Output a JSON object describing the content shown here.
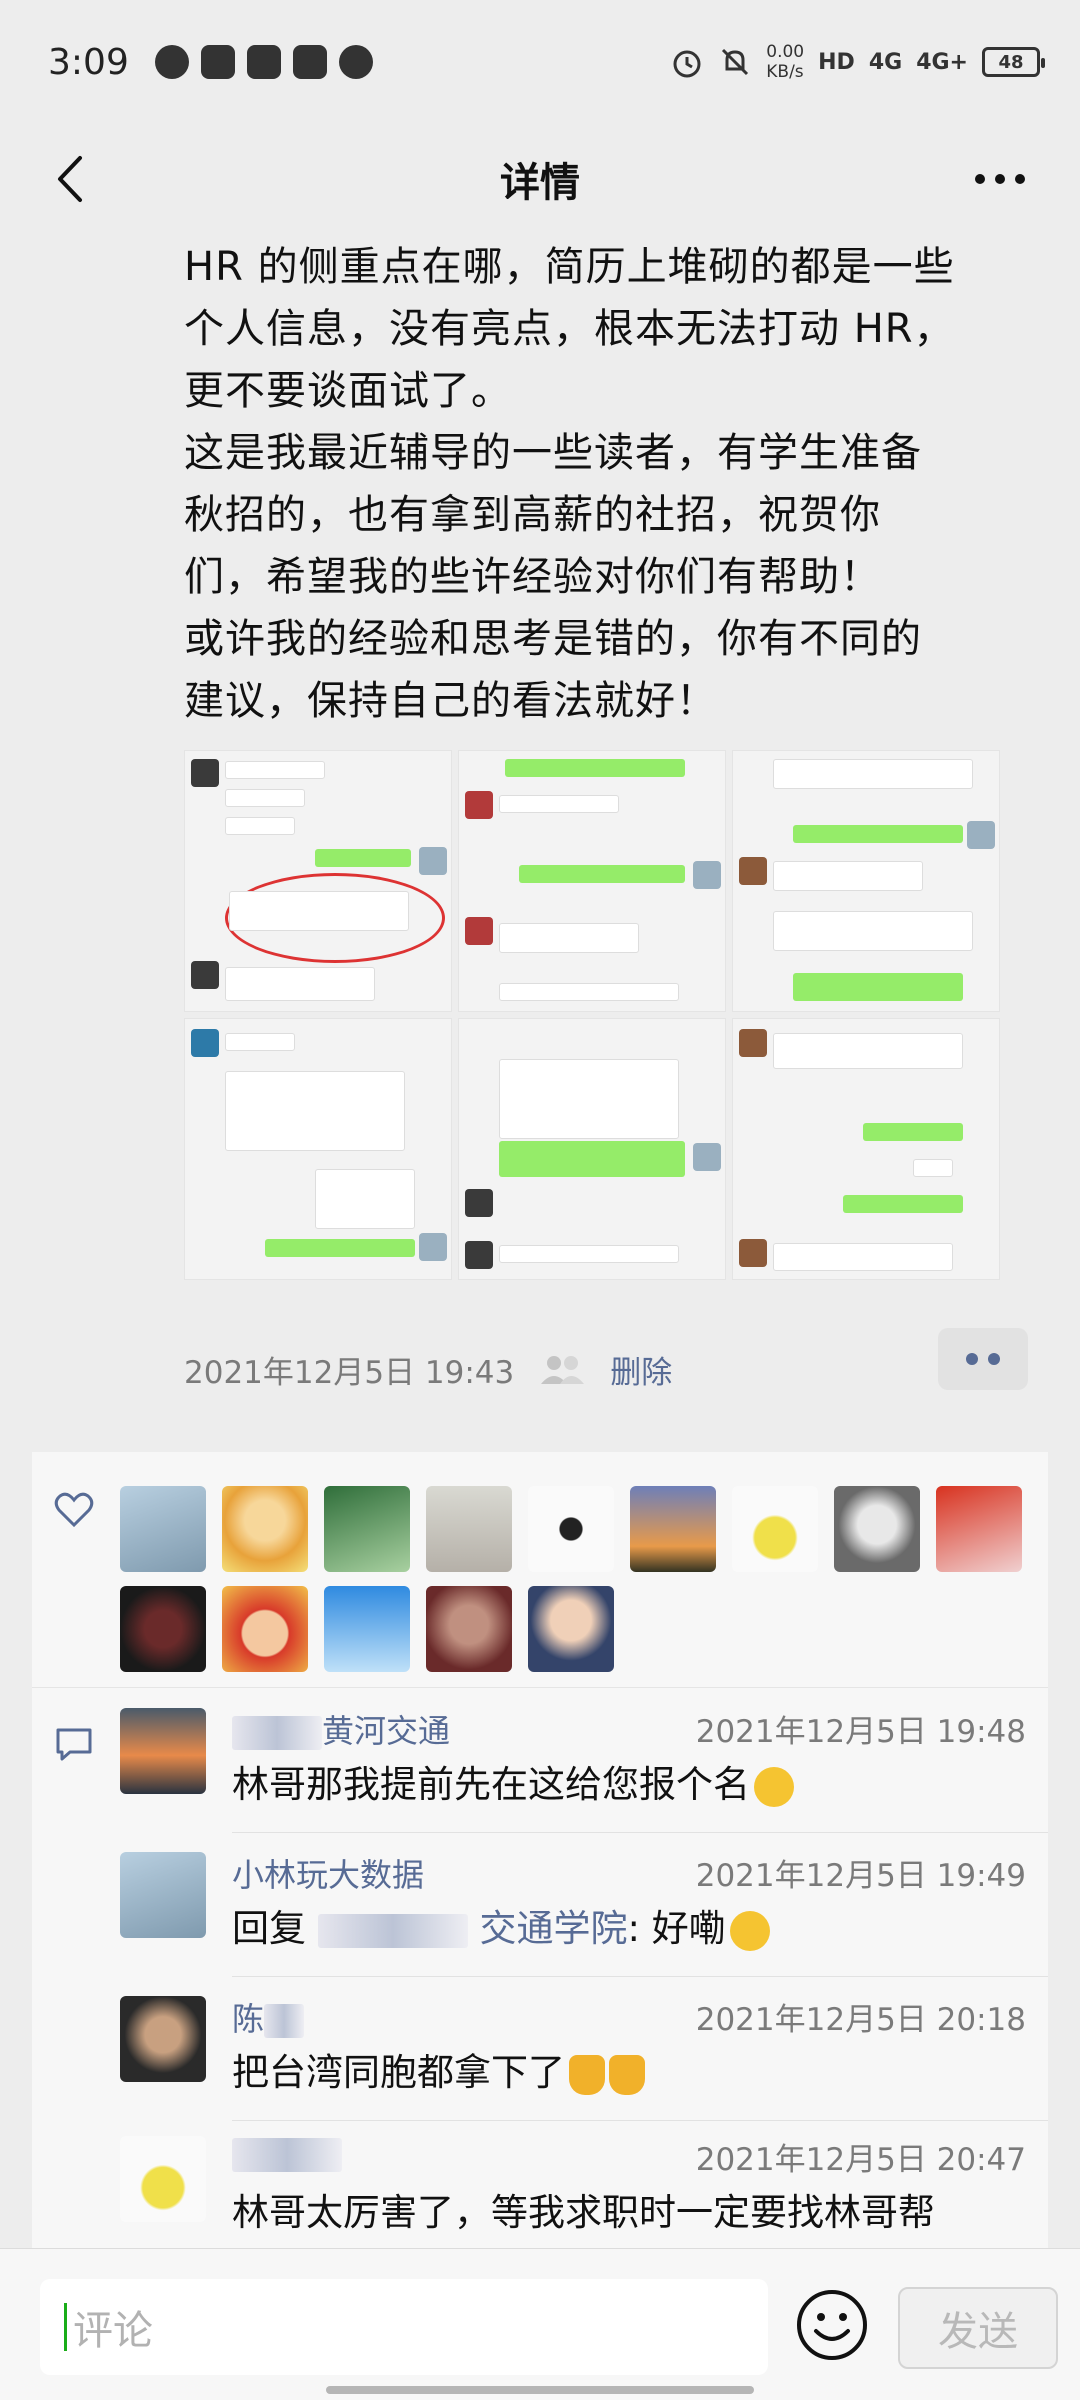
{
  "status_bar": {
    "time": "3:09",
    "speed_value": "0.00",
    "speed_unit": "KB/s",
    "hd_label": "HD",
    "net1": "4G",
    "net2": "4G+",
    "battery": "48"
  },
  "nav": {
    "title": "详情"
  },
  "post": {
    "text_lines": [
      "HR 的侧重点在哪，简历上堆砌的都是一些",
      "个人信息，没有亮点，根本无法打动 HR，",
      "更不要谈面试了。",
      "这是我最近辅导的一些读者，有学生准备",
      "秋招的，也有拿到高薪的社招，祝贺你",
      "们，希望我的些许经验对你们有帮助！",
      "或许我的经验和思考是错的，你有不同的",
      "建议，保持自己的看法就好！"
    ],
    "timestamp": "2021年12月5日 19:43",
    "delete_label": "删除"
  },
  "colors": {
    "link": "#576b95",
    "wechat_green": "#95ec69",
    "background": "#ededed"
  },
  "likes": {
    "avatar_colors": [
      "#9cb4c8",
      "#f0d060",
      "#5a9a5a",
      "#c8c8c0",
      "#f4f4f4",
      "#c87a3a",
      "#e8e860",
      "#707070",
      "#d43a2a",
      "#5a3a3a",
      "#f2c090",
      "#3a8ad8",
      "#8a3a3a",
      "#4a5a7a"
    ]
  },
  "comments": [
    {
      "name_visible": "黄河交通",
      "time": "2021年12月5日 19:48",
      "text": "林哥那我提前先在这给您报个名"
    },
    {
      "name": "小林玩大数据",
      "time": "2021年12月5日 19:49",
      "reply_prefix": "回复",
      "reply_target_visible": "交通学院",
      "reply_text": ": 好嘞"
    },
    {
      "name_visible": "陈",
      "time": "2021年12月5日 20:18",
      "text": "把台湾同胞都拿下了"
    },
    {
      "name_visible": "",
      "time": "2021年12月5日 20:47",
      "text": "林哥太厉害了，等我求职时一定要找林哥帮"
    }
  ],
  "input": {
    "placeholder": "评论",
    "send_label": "发送"
  }
}
